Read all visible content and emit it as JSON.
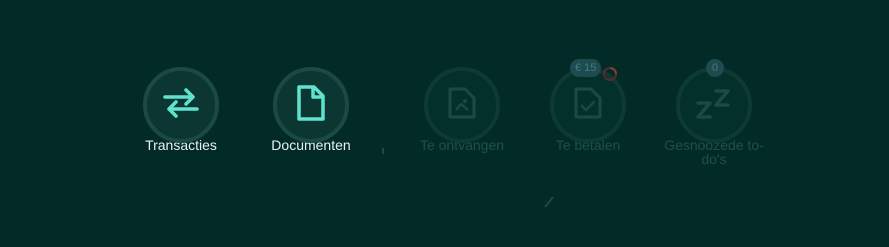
{
  "actions": [
    {
      "label": "Transacties",
      "icon": "swap-arrows-icon"
    },
    {
      "label": "Documenten",
      "icon": "document-icon"
    }
  ],
  "todos": [
    {
      "label": "Te ontvangen",
      "icon": "image-document-icon"
    },
    {
      "label": "Te betalen",
      "icon": "payment-document-icon",
      "badge": "€ 15"
    },
    {
      "label": "Gesnoozede to-do's",
      "icon": "snooze-icon",
      "badge": "0"
    }
  ],
  "colors": {
    "background": "#022b27",
    "accent": "#5fe3cf",
    "ring": "#1b4a43",
    "muted": "#1e5048"
  }
}
